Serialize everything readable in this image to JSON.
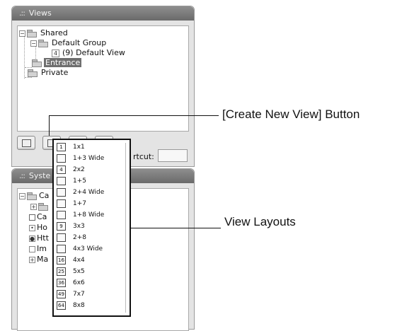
{
  "views_panel": {
    "title": "Views",
    "tree": {
      "shared": "Shared",
      "default_group": "Default Group",
      "default_view_badge": "4",
      "default_view": "(9) Default View",
      "entrance": "Entrance",
      "private": "Private"
    },
    "shortcut_label": "rtcut:"
  },
  "system_panel": {
    "title": "Syste",
    "items": [
      "Ca",
      "Ca",
      "Ho",
      "Htt",
      "Im",
      "Ma"
    ]
  },
  "layout_menu": {
    "items": [
      {
        "icon": "1",
        "label": "1x1"
      },
      {
        "icon": "",
        "label": "1+3 Wide"
      },
      {
        "icon": "4",
        "label": "2x2"
      },
      {
        "icon": "",
        "label": "1+5"
      },
      {
        "icon": "",
        "label": "2+4 Wide"
      },
      {
        "icon": "",
        "label": "1+7"
      },
      {
        "icon": "",
        "label": "1+8 Wide"
      },
      {
        "icon": "9",
        "label": "3x3"
      },
      {
        "icon": "",
        "label": "2+8"
      },
      {
        "icon": "",
        "label": "4x3 Wide"
      },
      {
        "icon": "16",
        "label": "4x4"
      },
      {
        "icon": "25",
        "label": "5x5"
      },
      {
        "icon": "36",
        "label": "6x6"
      },
      {
        "icon": "49",
        "label": "7x7"
      },
      {
        "icon": "64",
        "label": "8x8"
      }
    ]
  },
  "callouts": {
    "create_view": "[Create New View] Button",
    "view_layouts": "View Layouts"
  }
}
